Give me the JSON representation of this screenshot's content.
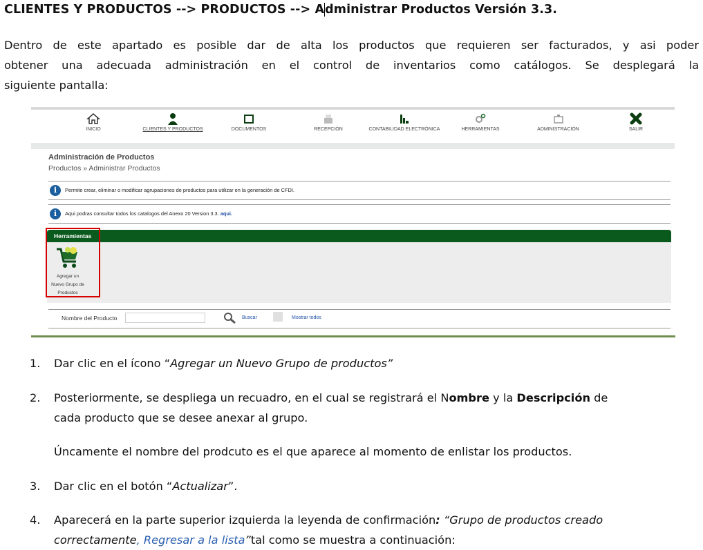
{
  "doc_title": {
    "part1": "CLIENTES Y PRODUCTOS --> PRODUCTOS --> A",
    "part2": "dministrar Productos Versión 3.3."
  },
  "intro": {
    "line1": "Dentro de este apartado es posible dar de alta los productos que requieren ser facturados, y asi poder",
    "line2": "obtener una adecuada administración en el control de inventarios como catálogos. Se desplegará la",
    "line3": "siguiente pantalla:"
  },
  "screenshot": {
    "nav": [
      {
        "label": "INICIO",
        "icon": "home-icon"
      },
      {
        "label": "CLIENTES Y PRODUCTOS",
        "icon": "user-icon"
      },
      {
        "label": "DOCUMENTOS",
        "icon": "folder-icon"
      },
      {
        "label": "RECEPCIÓN",
        "icon": "inbox-icon"
      },
      {
        "label": "CONTABILIDAD ELECTRÓNICA",
        "icon": "bar-chart-icon"
      },
      {
        "label": "HERRAMIENTAS",
        "icon": "gears-icon"
      },
      {
        "label": "ADMINISTRACIÓN",
        "icon": "admin-icon"
      },
      {
        "label": "SALIR",
        "icon": "exit-x-icon"
      }
    ],
    "panel_title": "Administración de Productos",
    "breadcrumb": "Productos » Administrar Productos",
    "info1": "Permite crear, eliminar o modificar agrupaciones de productos para utilizar en la generación de CFDI.",
    "info2_text": "Aqui podras consultar todos los catalogos del Anexo 20 Version 3.3.",
    "info2_link": "aqui.",
    "tools_header": "Herramientas",
    "tool_label_1": "Agregar un",
    "tool_label_2": "Nuevo Grupo de",
    "tool_label_3": "Productos",
    "search_label": "Nombre del Producto",
    "search_button": "Buscar",
    "show_all": "Mostrar todos",
    "colors": {
      "green_header": "#0b5a1d",
      "info_icon": "#1c5f9f",
      "highlight_box": "#d40000"
    }
  },
  "steps": [
    {
      "num": "1.",
      "prefix": "Dar clic en el ícono “",
      "italic": "Agregar un Nuevo Grupo de productos”"
    },
    {
      "num": "2.",
      "a": "Posteriormente, se despliega un recuadro, en el cual se registrará el N",
      "b": "ombre",
      "c": " y la ",
      "d": "Descripción",
      "e": " de",
      "line2": "cada producto que se desee anexar al grupo.",
      "note": "Úncamente el nombre  del prodcuto es el que aparece al momento de enlistar los productos."
    },
    {
      "num": "3.",
      "prefix": "Dar clic en el botón “",
      "italic": "Actualizar",
      "suffix": "”."
    },
    {
      "num": "4.",
      "prefix": "Aparecerá en la parte superior izquierda la leyenda de confirmación",
      "colon": ":",
      "quote": " “Grupo de productos creado",
      "line2_italic": "correctamente",
      "line2_blue": ", Regresar a la lista",
      "line2_close": "”",
      "line2_rest": "tal como se muestra a continuación:"
    }
  ]
}
